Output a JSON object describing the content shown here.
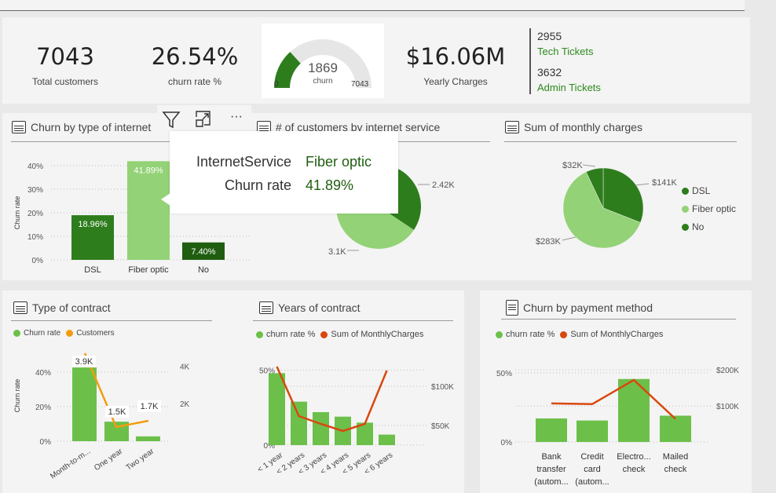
{
  "colors": {
    "dark_green": "#2e7d1d",
    "mid_green": "#6cc04a",
    "light_green": "#93d276",
    "darkest_green": "#1f5e10",
    "orange": "#f39c12",
    "red_orange": "#d9480f"
  },
  "kpis": {
    "total_customers": {
      "value": "7043",
      "label": "Total customers"
    },
    "churn_rate": {
      "value": "26.54%",
      "label": "churn rate %"
    },
    "gauge": {
      "value": "1869",
      "label": "churn",
      "min": "0",
      "max": "7043",
      "fraction": 0.2654
    },
    "yearly_charges": {
      "value": "$16.06M",
      "label": "Yearly Charges"
    },
    "tickets": {
      "tech_count": "2955",
      "tech_label": "Tech Tickets",
      "admin_count": "3632",
      "admin_label": "Admin Tickets"
    }
  },
  "visual_header": {
    "filter_icon": "filter-icon",
    "focus_icon": "focus-mode-icon",
    "more_icon": "more-options-icon",
    "more_label": "···"
  },
  "tooltip": {
    "row1_key": "InternetService",
    "row1_val": "Fiber optic",
    "row2_key": "Churn rate",
    "row2_val": "41.89%"
  },
  "chart_data": [
    {
      "id": "churn_internet",
      "type": "bar",
      "title": "Churn by type of internet",
      "ylabel": "Churn rate",
      "categories": [
        "DSL",
        "Fiber optic",
        "No"
      ],
      "values": [
        18.96,
        41.89,
        7.4
      ],
      "data_labels": [
        "18.96%",
        "41.89%",
        "7.40%"
      ],
      "yticks": [
        "0%",
        "10%",
        "20%",
        "30%",
        "40%"
      ],
      "ylim": [
        0,
        42
      ]
    },
    {
      "id": "customers_internet",
      "type": "pie",
      "title": "# of customers by internet service",
      "labels": [
        "2.42K",
        "3.1K"
      ],
      "values": [
        2.42,
        3.1,
        1.53
      ]
    },
    {
      "id": "monthly_charges",
      "type": "pie",
      "title": "Sum of monthly charges",
      "labels": [
        "$32K",
        "$141K",
        "$283K"
      ],
      "legend": [
        "DSL",
        "Fiber optic",
        "No"
      ],
      "values": [
        141,
        283,
        32
      ]
    },
    {
      "id": "type_contract",
      "type": "bar",
      "title": "Type of contract",
      "ylabel": "Churn rate",
      "legend": [
        "Churn rate",
        "Customers"
      ],
      "categories": [
        "Month-to-m...",
        "One year",
        "Two year"
      ],
      "values": [
        42.7,
        11.3,
        2.8
      ],
      "line_values": [
        3.9,
        1.5,
        1.7
      ],
      "line_labels": [
        "3.9K",
        "1.5K",
        "1.7K"
      ],
      "yticks": [
        "0%",
        "20%",
        "40%"
      ],
      "y2ticks": [
        "2K",
        "4K"
      ],
      "ylim": [
        0,
        50
      ],
      "y2lim": [
        0,
        4.6
      ]
    },
    {
      "id": "years_contract",
      "type": "bar",
      "title": "Years of contract",
      "legend": [
        "churn rate %",
        "Sum of MonthlyCharges"
      ],
      "categories": [
        "< 1 year",
        "< 2 years",
        "< 3 years",
        "< 4 years",
        "< 5 years",
        "< 6 years"
      ],
      "values": [
        48,
        29,
        22,
        19,
        15,
        7
      ],
      "line_values": [
        125,
        62,
        52,
        43,
        52,
        120
      ],
      "yticks": [
        "0%",
        "50%"
      ],
      "y2ticks": [
        "$50K",
        "$100K"
      ],
      "ylim": [
        0,
        55
      ],
      "y2lim": [
        25,
        130
      ]
    },
    {
      "id": "payment_method",
      "type": "bar",
      "title": "Churn by payment method",
      "legend": [
        "churn rate %",
        "Sum of MonthlyCharges"
      ],
      "categories": [
        [
          "Bank",
          "transfer",
          "(autom..."
        ],
        [
          "Credit",
          "card",
          "(autom..."
        ],
        [
          "Electro...",
          "check"
        ],
        [
          "Mailed",
          "check"
        ]
      ],
      "values": [
        17,
        15.5,
        45.5,
        19
      ],
      "line_values": [
        107,
        105,
        172,
        64
      ],
      "yticks": [
        "0%",
        "50%"
      ],
      "y2ticks": [
        "$100K",
        "$200K"
      ],
      "ylim": [
        0,
        55
      ],
      "y2lim": [
        0,
        220
      ]
    }
  ]
}
